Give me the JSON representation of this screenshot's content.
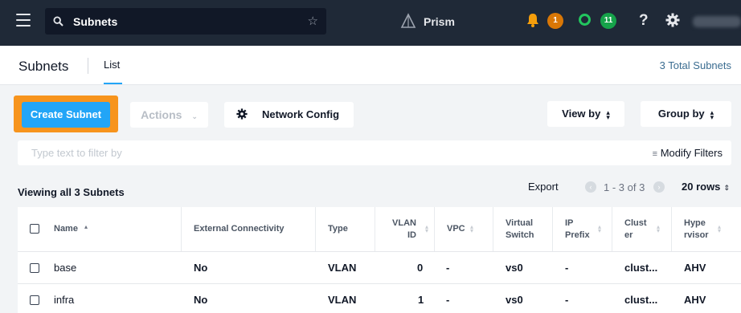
{
  "topbar": {
    "search_text": "Subnets",
    "app_name": "Prism",
    "alert_count": "1",
    "task_count": "11",
    "help_label": "?"
  },
  "header": {
    "title": "Subnets",
    "tab": "List",
    "total": "3 Total Subnets"
  },
  "toolbar": {
    "create_label": "Create Subnet",
    "actions_label": "Actions",
    "network_config_label": "Network Config",
    "view_by_label": "View by",
    "group_by_label": "Group by"
  },
  "filter": {
    "placeholder": "Type text to filter by",
    "modify_label": "Modify Filters"
  },
  "list": {
    "viewing": "Viewing all 3 Subnets",
    "export": "Export",
    "range": "1 - 3 of 3",
    "rows": "20 rows"
  },
  "table": {
    "headers": {
      "name": "Name",
      "external": "External Connectivity",
      "type": "Type",
      "vlan": "VLAN ID",
      "vpc": "VPC",
      "vswitch": "Virtual Switch",
      "ip": "IP Prefix",
      "cluster": "Clust er",
      "hypervisor": "Hype rvisor"
    },
    "rows": [
      {
        "name": "base",
        "external": "No",
        "type": "VLAN",
        "vlan": "0",
        "vpc": "-",
        "vswitch": "vs0",
        "ip": "-",
        "cluster": "clust...",
        "hypervisor": "AHV"
      },
      {
        "name": "infra",
        "external": "No",
        "type": "VLAN",
        "vlan": "1",
        "vpc": "-",
        "vswitch": "vs0",
        "ip": "-",
        "cluster": "clust...",
        "hypervisor": "AHV"
      }
    ]
  },
  "colors": {
    "topbar": "#1f2937",
    "primary": "#22a5f7",
    "highlight": "#f7941d",
    "alert": "#d97706",
    "ok": "#16a34a"
  }
}
